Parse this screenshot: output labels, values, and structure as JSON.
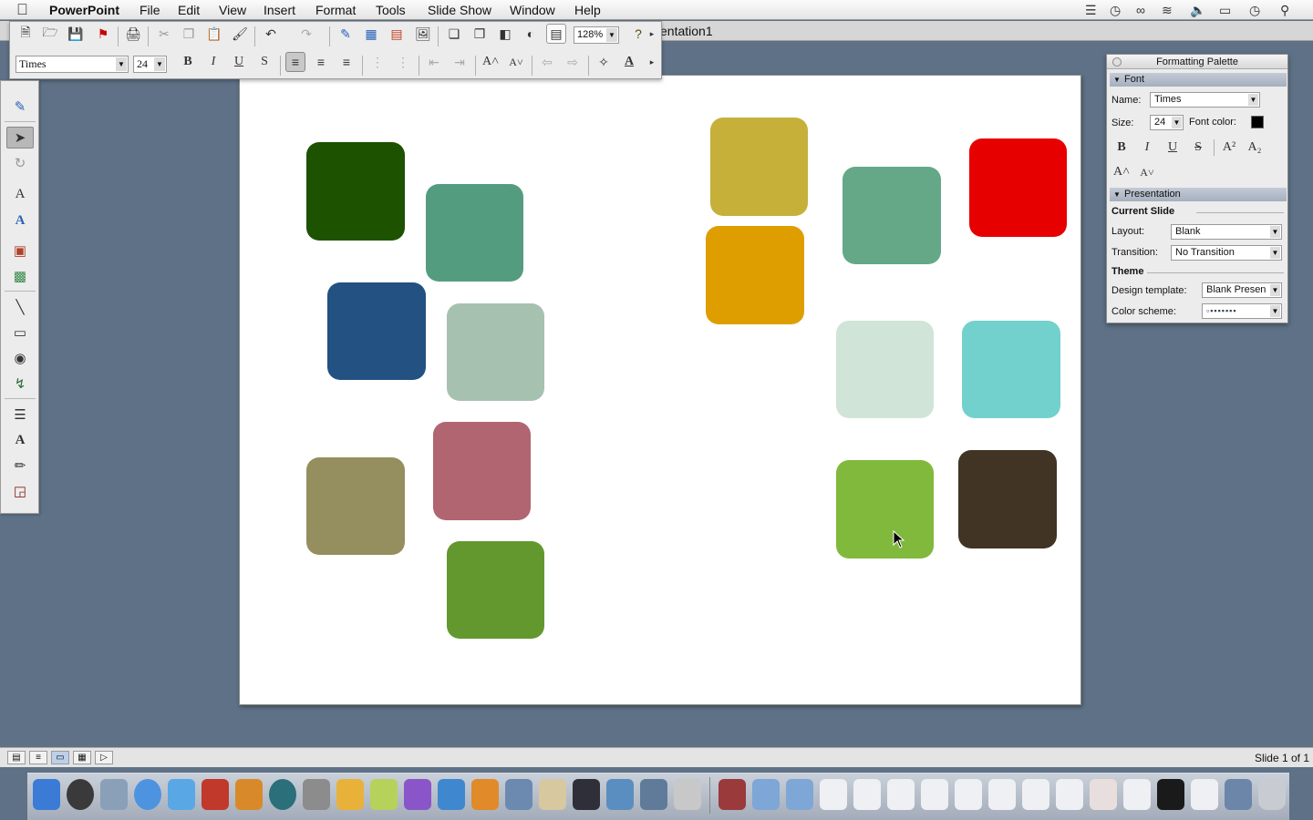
{
  "menubar": {
    "app_name": "PowerPoint",
    "items": [
      "File",
      "Edit",
      "View",
      "Insert",
      "Format",
      "Tools",
      "Slide Show",
      "Window",
      "Help"
    ]
  },
  "window": {
    "title": "entation1"
  },
  "toolbar": {
    "font_name": "Times",
    "font_size": "24",
    "zoom": "128%"
  },
  "slide": {
    "shapes": [
      {
        "color": "#1c5200"
      },
      {
        "color": "#549c80"
      },
      {
        "color": "#225182"
      },
      {
        "color": "#a6c1b0"
      },
      {
        "color": "#b06570"
      },
      {
        "color": "#958e5e"
      },
      {
        "color": "#62982e"
      },
      {
        "color": "#c6b03a"
      },
      {
        "color": "#df9e00"
      },
      {
        "color": "#64a888"
      },
      {
        "color": "#e60000"
      },
      {
        "color": "#d0e4d8"
      },
      {
        "color": "#72d1cc"
      },
      {
        "color": "#80b93b"
      },
      {
        "color": "#413425"
      }
    ]
  },
  "palette": {
    "title": "Formatting Palette",
    "font_pane": "Font",
    "name_label": "Name:",
    "name_value": "Times",
    "size_label": "Size:",
    "size_value": "24",
    "font_color_label": "Font color:",
    "font_color": "#000000",
    "presentation_pane": "Presentation",
    "current_slide_label": "Current Slide",
    "layout_label": "Layout:",
    "layout_value": "Blank",
    "transition_label": "Transition:",
    "transition_value": "No Transition",
    "theme_label": "Theme",
    "design_template_label": "Design template:",
    "design_template_value": "Blank Presen",
    "color_scheme_label": "Color scheme:"
  },
  "statusbar": {
    "slide_count": "Slide 1 of 1"
  }
}
